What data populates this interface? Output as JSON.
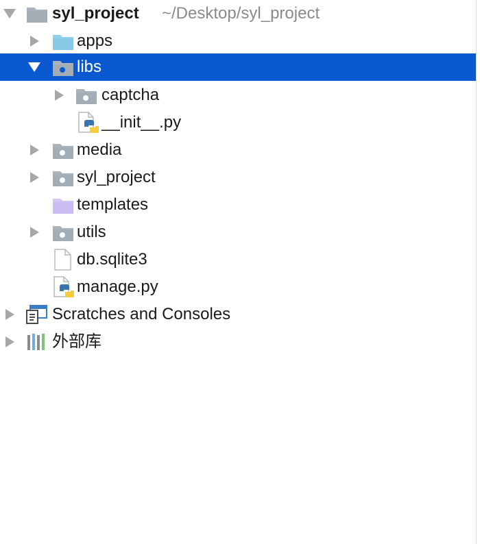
{
  "project": {
    "name": "syl_project",
    "path": "~/Desktop/syl_project",
    "items": [
      {
        "label": "apps",
        "icon": "folder-icon"
      },
      {
        "label": "libs",
        "icon": "folder-icon",
        "selected": true
      },
      {
        "label": "captcha",
        "icon": "folder-icon"
      },
      {
        "label": "__init__.py",
        "icon": "python-file-icon"
      },
      {
        "label": "media",
        "icon": "folder-icon"
      },
      {
        "label": "syl_project",
        "icon": "folder-icon"
      },
      {
        "label": "templates",
        "icon": "folder-icon"
      },
      {
        "label": "utils",
        "icon": "folder-icon"
      },
      {
        "label": "db.sqlite3",
        "icon": "file-icon"
      },
      {
        "label": "manage.py",
        "icon": "python-file-icon"
      }
    ]
  },
  "scratches": {
    "label": "Scratches and Consoles",
    "icon": "scratches-icon"
  },
  "external_libraries": {
    "label": "外部库",
    "icon": "library-icon"
  },
  "colors": {
    "selection": "#0b59d1",
    "folder_gray": "#a9b3bb",
    "folder_blue": "#8fd0ea",
    "folder_purple": "#d3c6f5",
    "arrow": "#a7a7a7"
  }
}
